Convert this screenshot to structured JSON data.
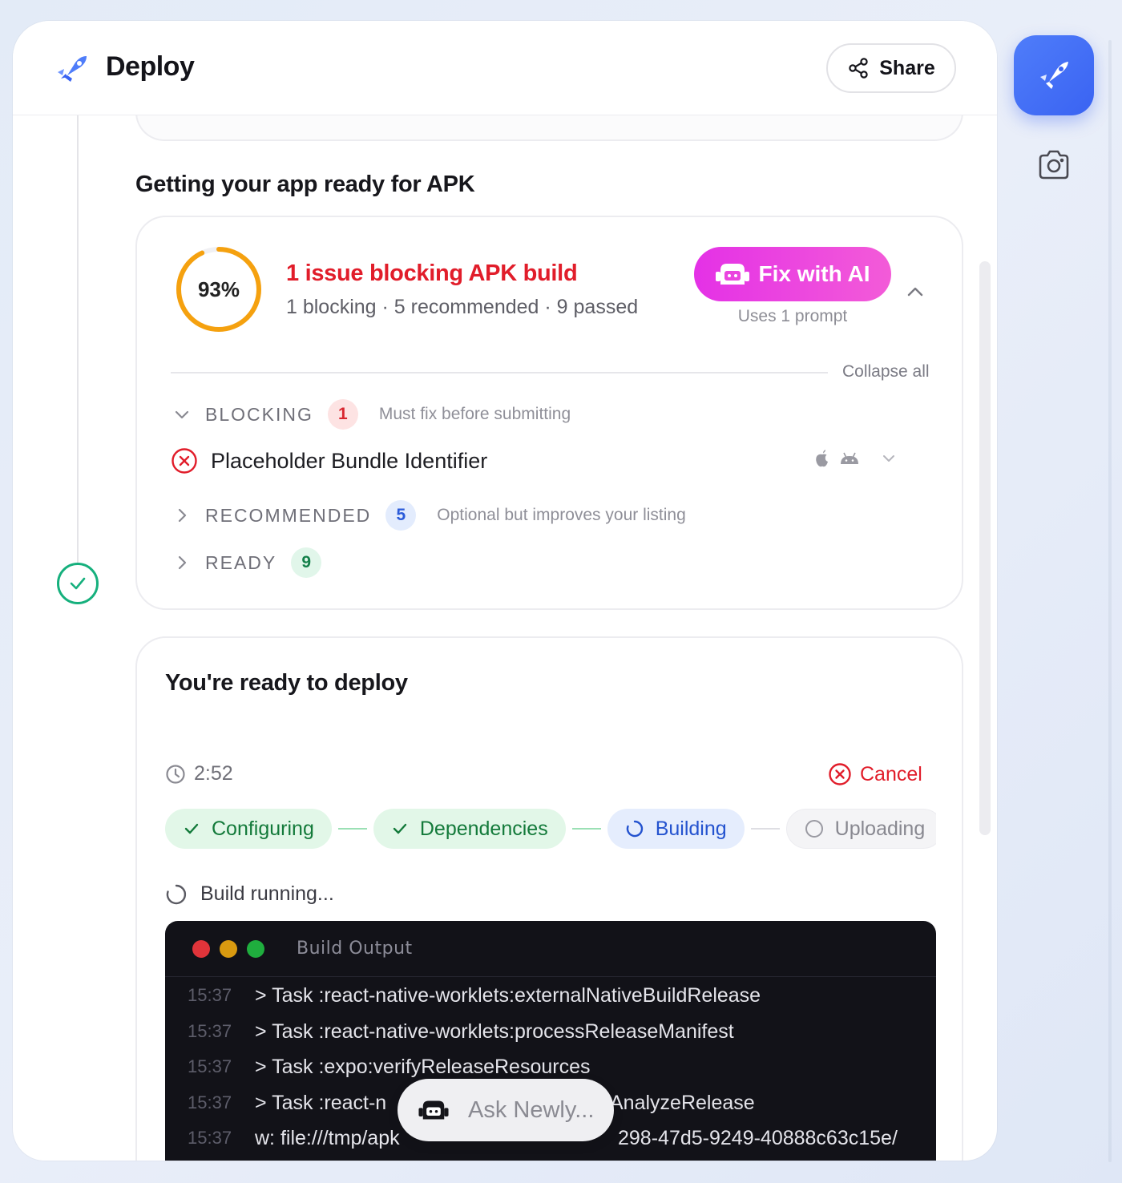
{
  "header": {
    "title": "Deploy",
    "share_label": "Share"
  },
  "section": {
    "title": "Getting your app ready for APK"
  },
  "readiness": {
    "percent_label": "93%",
    "percent": 93,
    "issue_title": "1 issue blocking APK build",
    "summary": "1 blocking · 5 recommended · 9 passed",
    "fix_button": "Fix with AI",
    "fix_sub": "Uses 1 prompt",
    "collapse_all": "Collapse all",
    "groups": [
      {
        "label": "BLOCKING",
        "count": "1",
        "desc": "Must fix before submitting"
      },
      {
        "label": "RECOMMENDED",
        "count": "5",
        "desc": "Optional but improves your listing"
      },
      {
        "label": "READY",
        "count": "9",
        "desc": ""
      }
    ],
    "blocking_issue": "Placeholder Bundle Identifier"
  },
  "deploy": {
    "title": "You're ready to deploy",
    "timer": "2:52",
    "cancel_label": "Cancel",
    "steps": [
      {
        "label": "Configuring",
        "state": "done"
      },
      {
        "label": "Dependencies",
        "state": "done"
      },
      {
        "label": "Building",
        "state": "active"
      },
      {
        "label": "Uploading",
        "state": "pending"
      }
    ],
    "status": "Build running...",
    "terminal_title": "Build Output",
    "log": [
      {
        "time": "15:37",
        "text": "> Task :react-native-worklets:externalNativeBuildRelease"
      },
      {
        "time": "15:37",
        "text": "> Task :react-native-worklets:processReleaseManifest"
      },
      {
        "time": "15:37",
        "text": "> Task :expo:verifyReleaseResources"
      },
      {
        "time": "15:37",
        "text": "> Task :react-n"
      },
      {
        "time": "15:37",
        "text": "w: file:///tmp/apk"
      }
    ],
    "log_tail_4": "AnalyzeRelease",
    "log_tail_5": "298-47d5-9249-40888c63c15e/"
  },
  "ask": {
    "placeholder": "Ask Newly..."
  },
  "colors": {
    "accent": "#3a63f2",
    "danger": "#e11d2a",
    "success": "#16b07d",
    "fix_gradient": "#e431e6"
  },
  "icons": [
    "rocket-icon",
    "share-icon",
    "camera-icon",
    "check-circle-icon",
    "x-circle-icon",
    "apple-icon",
    "android-icon",
    "clock-icon",
    "spinner-icon",
    "robot-icon"
  ]
}
